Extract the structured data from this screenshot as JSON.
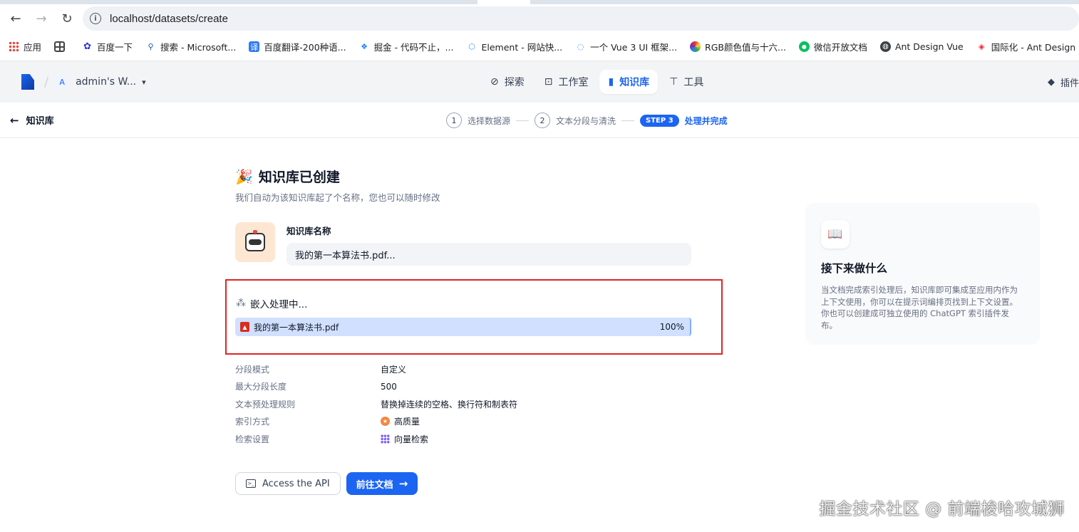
{
  "browser": {
    "url": "localhost/datasets/create",
    "bookmarks": [
      {
        "label": "应用",
        "icon": "apps-grid-icon"
      },
      {
        "label": "",
        "icon": "tab-groups-icon"
      },
      {
        "label": "百度一下",
        "icon": "baidu-paw-icon"
      },
      {
        "label": "搜索 - Microsoft...",
        "icon": "bing-search-icon"
      },
      {
        "label": "百度翻译-200种语...",
        "icon": "baidu-translate-icon"
      },
      {
        "label": "掘金 - 代码不止，...",
        "icon": "juejin-icon"
      },
      {
        "label": "Element - 网站快...",
        "icon": "element-icon"
      },
      {
        "label": "一个 Vue 3 UI 框架...",
        "icon": "vue-ui-icon"
      },
      {
        "label": "RGB颜色值与十六...",
        "icon": "rainbow-icon"
      },
      {
        "label": "微信开放文档",
        "icon": "wechat-icon"
      },
      {
        "label": "Ant Design Vue",
        "icon": "globe-icon"
      },
      {
        "label": "国际化 - Ant Design",
        "icon": "ant-design-icon"
      }
    ]
  },
  "header": {
    "workspace_initial": "A",
    "workspace_name": "admin's W...",
    "nav": [
      {
        "label": "探索",
        "icon": "compass-icon",
        "active": false
      },
      {
        "label": "工作室",
        "icon": "robot-icon",
        "active": false
      },
      {
        "label": "知识库",
        "icon": "book-icon",
        "active": true
      },
      {
        "label": "工具",
        "icon": "hammer-icon",
        "active": false
      }
    ],
    "plugins_label": "插件"
  },
  "steps_bar": {
    "back_label": "知识库",
    "step1_num": "1",
    "step1_label": "选择数据源",
    "step2_num": "2",
    "step2_label": "文本分段与清洗",
    "step3_badge": "STEP 3",
    "step3_label": "处理并完成"
  },
  "main": {
    "title": "知识库已创建",
    "subtitle": "我们自动为该知识库起了个名称，您也可以随时修改",
    "name_label": "知识库名称",
    "name_value": "我的第一本算法书.pdf...",
    "embed_status": "嵌入处理中...",
    "file": {
      "name": "我的第一本算法书.pdf",
      "progress": "100%"
    },
    "info": [
      {
        "key": "分段模式",
        "value": "自定义"
      },
      {
        "key": "最大分段长度",
        "value": "500"
      },
      {
        "key": "文本预处理规则",
        "value": "替换掉连续的空格、换行符和制表符"
      },
      {
        "key": "索引方式",
        "value": "高质量"
      },
      {
        "key": "检索设置",
        "value": "向量检索"
      }
    ],
    "api_button": "Access the API",
    "docs_button": "前往文档"
  },
  "side_card": {
    "title": "接下来做什么",
    "text": "当文档完成索引处理后，知识库即可集成至应用内作为上下文使用，你可以在提示词编排页找到上下文设置。你也可以创建成可独立使用的 ChatGPT 索引插件发布。"
  },
  "watermark": "掘金技术社区 @ 前端梭哈攻城狮",
  "colors": {
    "accent": "#1c64f2",
    "highlight_border": "#e02424",
    "progress_fill": "#d1e0ff"
  }
}
